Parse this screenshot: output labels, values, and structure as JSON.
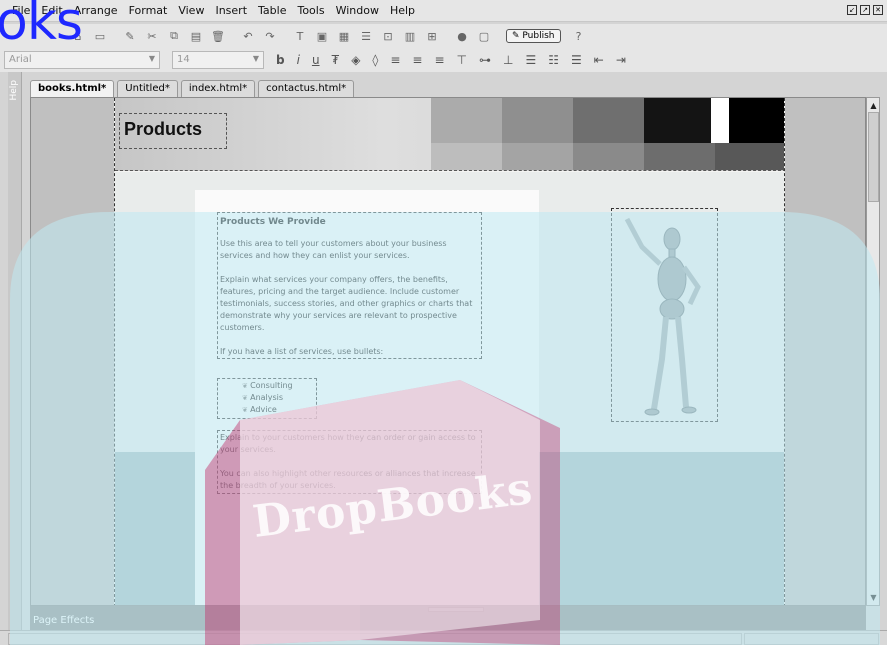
{
  "logo": {
    "text": "oks"
  },
  "menubar": {
    "items": [
      "File",
      "Edit",
      "Arrange",
      "Format",
      "View",
      "Insert",
      "Table",
      "Tools",
      "Window",
      "Help"
    ]
  },
  "toolbar": {
    "publish_label": "Publish",
    "icons": [
      "new-page-icon",
      "open-icon",
      "save-icon",
      "print-icon",
      "cut-icon",
      "copy-icon",
      "paste-icon",
      "delete-icon",
      "undo-icon",
      "redo-icon",
      "text-icon",
      "image-icon",
      "table-icon",
      "form-icon",
      "insert-icon",
      "layout-icon",
      "link-icon",
      "publish-icon",
      "help-icon"
    ]
  },
  "format_toolbar": {
    "font_value": "Arial",
    "size_value": "14",
    "bold": "b",
    "italic": "i",
    "underline": "u"
  },
  "help_panel": {
    "label": "Help"
  },
  "tabs": [
    {
      "label": "books.html*",
      "active": true
    },
    {
      "label": "Untitled*",
      "active": false
    },
    {
      "label": "index.html*",
      "active": false
    },
    {
      "label": "contactus.html*",
      "active": false
    }
  ],
  "page": {
    "banner_title": "Products",
    "swatches": [
      "#a8a8a8",
      "#8f8f8f",
      "#6e6e6e",
      "#1a1a1a",
      "#ffffff",
      "#000000"
    ],
    "heading": "Products We Provide",
    "paragraph1": "Use this area to tell your customers about your business services and how they can enlist your services.",
    "paragraph2": "Explain what services your company offers, the benefits, features, pricing and the target audience. Include customer testimonials, success stories, and other graphics or charts that demonstrate why your services are relevant to prospective customers.",
    "paragraph3": "If you have a list of services, use bullets:",
    "bullets": [
      "Consulting",
      "Analysis",
      "Advice"
    ],
    "paragraph4": "Explain to your customers how they can order or gain access to your services.",
    "paragraph5": "You can also highlight other resources or alliances that increase the breadth of your services."
  },
  "bottom_panel": {
    "label": "Page Effects"
  },
  "watermark": {
    "text": "DropBooks"
  },
  "colors": {
    "logo": "#1e28ff",
    "watermark_fill": "#bfeaf3",
    "watermark_book": "#c0306a"
  }
}
